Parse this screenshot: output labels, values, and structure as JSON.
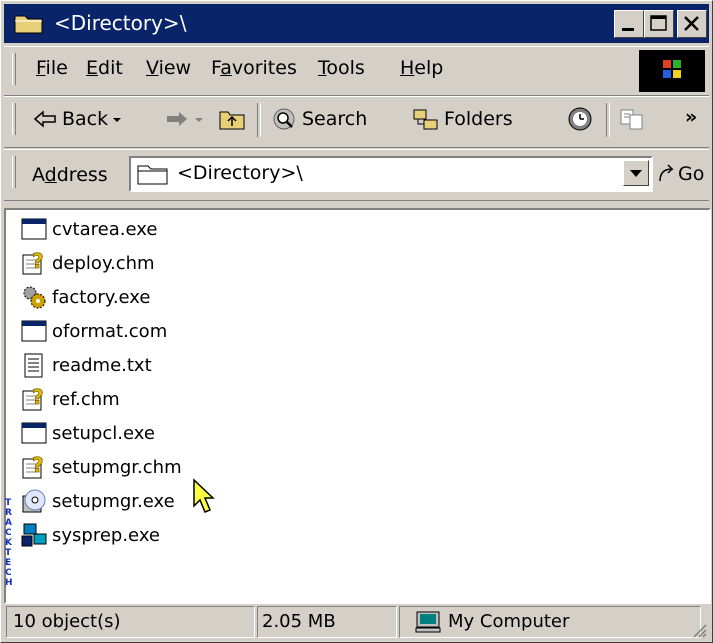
{
  "window": {
    "title": "<Directory>\\"
  },
  "menu": {
    "items": [
      {
        "label": "File",
        "u": "F",
        "rest": "ile"
      },
      {
        "label": "Edit",
        "u": "E",
        "rest": "dit"
      },
      {
        "label": "View",
        "u": "V",
        "rest": "iew"
      },
      {
        "label": "Favorites",
        "pre": "F",
        "u": "a",
        "rest": "vorites"
      },
      {
        "label": "Tools",
        "u": "T",
        "rest": "ools"
      },
      {
        "label": "Help",
        "u": "H",
        "rest": "elp"
      }
    ]
  },
  "toolbar": {
    "back_label": "Back",
    "search_label": "Search",
    "folders_label": "Folders",
    "chevron": "»"
  },
  "address": {
    "label_pre": "A",
    "label_u": "d",
    "label_rest": "dress",
    "value": "<Directory>\\",
    "go_label": "Go"
  },
  "files": [
    {
      "name": "cvtarea.exe",
      "icon": "window-app-icon"
    },
    {
      "name": "deploy.chm",
      "icon": "help-file-icon"
    },
    {
      "name": "factory.exe",
      "icon": "gears-app-icon"
    },
    {
      "name": "oformat.com",
      "icon": "window-app-icon"
    },
    {
      "name": "readme.txt",
      "icon": "text-file-icon"
    },
    {
      "name": "ref.chm",
      "icon": "help-file-icon"
    },
    {
      "name": "setupcl.exe",
      "icon": "window-app-icon"
    },
    {
      "name": "setupmgr.chm",
      "icon": "help-file-icon"
    },
    {
      "name": "setupmgr.exe",
      "icon": "setup-cd-icon"
    },
    {
      "name": "sysprep.exe",
      "icon": "network-app-icon"
    }
  ],
  "status": {
    "objects": "10 object(s)",
    "size": "2.05 MB",
    "zone": "My Computer"
  },
  "watermark": "TRACKTECH",
  "colors": {
    "titlebar": "#0a246a",
    "face": "#d4d0c8"
  }
}
